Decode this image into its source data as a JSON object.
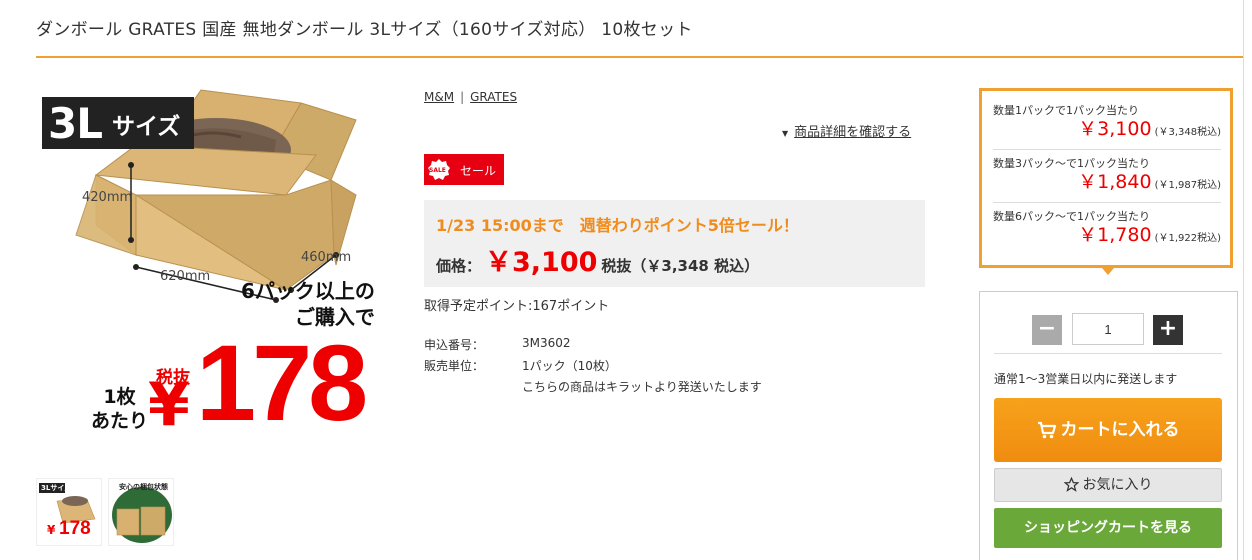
{
  "product": {
    "title": "ダンボール GRATES 国産 無地ダンボール 3Lサイズ（160サイズ対応） 10枚セット"
  },
  "image": {
    "size_badge_big": "3L",
    "size_badge_small": "サイズ",
    "dim_height": "420mm",
    "dim_width": "620mm",
    "dim_depth": "460mm",
    "promo_line1": "6パック以上の",
    "promo_line2": "ご購入で",
    "tax_label": "税抜",
    "per_line1": "1枚",
    "per_line2": "あたり",
    "yen": "¥",
    "price": "178"
  },
  "brands": [
    "M&M",
    "GRATES"
  ],
  "brand_separator": "|",
  "detail_link": {
    "marker": "▼",
    "label": "商品詳細を確認する"
  },
  "sale": {
    "icon_text": "SALE",
    "label": "セール"
  },
  "campaign": "1/23 15:00まで　週替わりポイント5倍セール！",
  "price": {
    "label": "価格：",
    "value": "￥3,100",
    "tax_note": "税抜（￥3,348 税込）"
  },
  "points": "取得予定ポイント:167ポイント",
  "specs": [
    {
      "label": "申込番号：",
      "value": "3M3602"
    },
    {
      "label": "販売単位：",
      "value": "1パック（10枚）"
    },
    {
      "label": "",
      "value": "こちらの商品はキラットより発送いたします"
    }
  ],
  "quantity_prices": [
    {
      "condition": "数量1パックで1パック当たり",
      "price": "￥3,100",
      "tax": "(￥3,348税込)"
    },
    {
      "condition": "数量3パック～で1パック当たり",
      "price": "￥1,840",
      "tax": "(￥1,987税込)"
    },
    {
      "condition": "数量6パック～で1パック当たり",
      "price": "￥1,780",
      "tax": "(￥1,922税込)"
    }
  ],
  "cart": {
    "minus": "−",
    "plus": "+",
    "quantity": "1",
    "ship_note": "通常1～3営業日以内に発送します",
    "add_to_cart": "カートに入れる",
    "favorite": "お気に入り",
    "view_cart": "ショッピングカートを見る"
  },
  "thumbnails": [
    {
      "label": "3Lサイズ",
      "price": "178",
      "yen": "¥"
    },
    {
      "label": "安心の梱包状態"
    }
  ],
  "colors": {
    "accent_orange": "#f0a030",
    "price_red": "#e60012",
    "campaign_orange": "#f08c1e",
    "cart_button": "#f39a14",
    "shop_button": "#6aa83a"
  },
  "icons": [
    "cart-icon",
    "star-outline-icon",
    "sale-tag-icon",
    "triangle-down-icon"
  ]
}
